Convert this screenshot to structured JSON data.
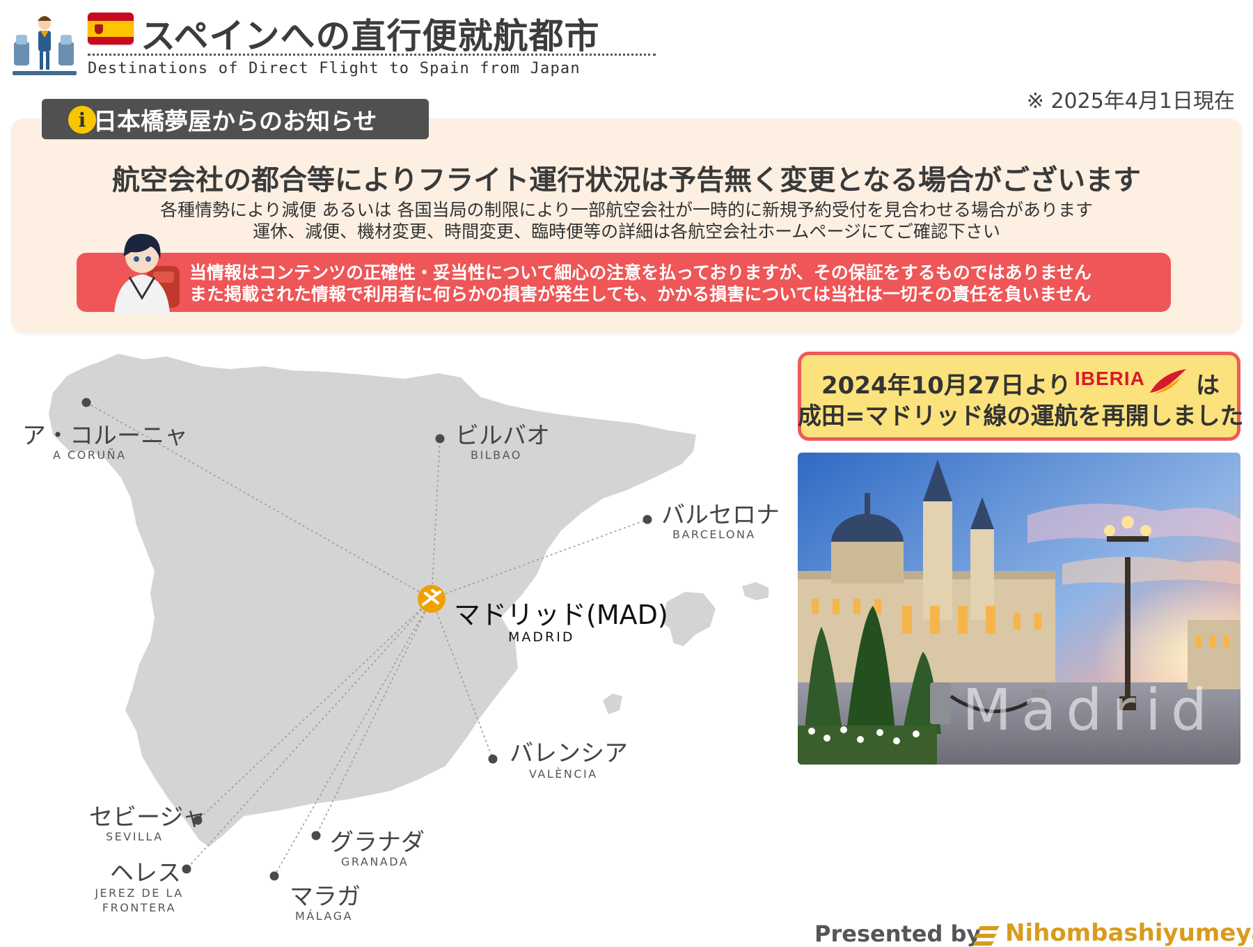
{
  "header": {
    "title": "スペインへの直行便就航都市",
    "subtitle": "Destinations of Direct Flight to Spain from Japan",
    "as_of": "※ 2025年4月1日現在"
  },
  "notice": {
    "tab_label": "日本橋夢屋からのお知らせ",
    "info_icon_glyph": "i",
    "headline": "航空会社の都合等によりフライト運行状況は予告無く変更となる場合がございます",
    "line1": "各種情勢により減便 あるいは 各国当局の制限により一部航空会社が一時的に新規予約受付を見合わせる場合があります",
    "line2": "運休、減便、機材変更、時間変更、臨時便等の詳細は各航空会社ホームページにてご確認下さい",
    "disclaimer1": "当情報はコンテンツの正確性・妥当性について細心の注意を払っておりますが、その保証をするものではありません",
    "disclaimer2": "また掲載された情報で利用者に何らかの損害が発生しても、かかる損害については当社は一切その責任を負いません"
  },
  "map": {
    "hub": {
      "name_ja": "マドリッド(MAD)",
      "name_en": "MADRID"
    },
    "cities": [
      {
        "key": "coruna",
        "name_ja": "ア・コルーニャ",
        "name_en": "A CORUÑA"
      },
      {
        "key": "bilbao",
        "name_ja": "ビルバオ",
        "name_en": "BILBAO"
      },
      {
        "key": "barcelona",
        "name_ja": "バルセロナ",
        "name_en": "BARCELONA"
      },
      {
        "key": "valencia",
        "name_ja": "バレンシア",
        "name_en": "VALÈNCIA"
      },
      {
        "key": "sevilla",
        "name_ja": "セビージャ",
        "name_en": "SEVILLA"
      },
      {
        "key": "granada",
        "name_ja": "グラナダ",
        "name_en": "GRANADA"
      },
      {
        "key": "jerez",
        "name_ja": "ヘレス",
        "name_en": "JEREZ DE LA FRONTERA"
      },
      {
        "key": "malaga",
        "name_ja": "マラガ",
        "name_en": "MÁLAGA"
      }
    ],
    "colors": {
      "land": "#d4d4d4",
      "route": "#9a9a9a",
      "hub": "#f0a000",
      "dot": "#4a4a4a"
    }
  },
  "iberia": {
    "line1": "2024年10月27日より",
    "logo_text": "IBERIA",
    "particle": "は",
    "line2": "成田=マドリッド線の運航を再開しました"
  },
  "photo": {
    "caption": "Madrid"
  },
  "footer": {
    "presented_by": "Presented by",
    "brand": "Nihombashiyumeya"
  }
}
